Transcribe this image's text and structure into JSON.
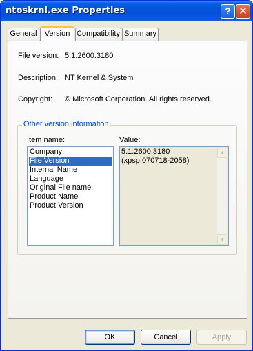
{
  "window": {
    "title": "ntoskrnl.exe Properties",
    "help_glyph": "?",
    "close_glyph": "✕"
  },
  "tabs": [
    {
      "label": "General"
    },
    {
      "label": "Version",
      "active": true
    },
    {
      "label": "Compatibility"
    },
    {
      "label": "Summary"
    }
  ],
  "version_tab": {
    "file_version_label": "File version:",
    "file_version_value": "5.1.2600.3180",
    "description_label": "Description:",
    "description_value": "NT Kernel & System",
    "copyright_label": "Copyright:",
    "copyright_value": "© Microsoft Corporation. All rights reserved.",
    "group_title": "Other version information",
    "item_name_label": "Item name:",
    "value_label": "Value:",
    "items": [
      "Company",
      "File Version",
      "Internal Name",
      "Language",
      "Original File name",
      "Product Name",
      "Product Version"
    ],
    "selected_index": 1,
    "value_lines": [
      "5.1.2600.3180",
      "(xpsp.070718-2058)"
    ]
  },
  "buttons": {
    "ok": "OK",
    "cancel": "Cancel",
    "apply": "Apply"
  },
  "icons": {
    "scroll_up": "up-arrow-icon",
    "scroll_down": "down-arrow-icon"
  },
  "colors": {
    "title_bar": "#0453DA",
    "selection": "#316AC5",
    "group_title": "#0046D5"
  }
}
